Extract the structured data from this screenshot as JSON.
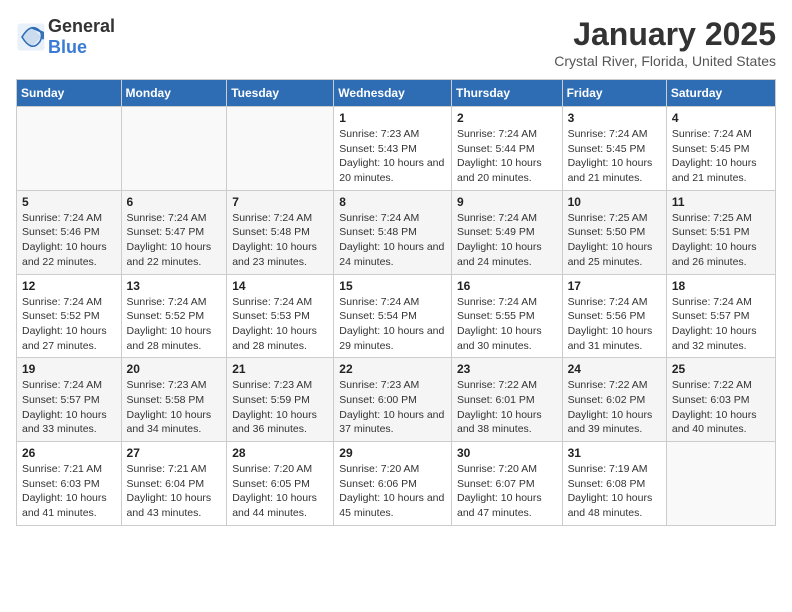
{
  "header": {
    "logo_general": "General",
    "logo_blue": "Blue",
    "title": "January 2025",
    "subtitle": "Crystal River, Florida, United States"
  },
  "calendar": {
    "days_of_week": [
      "Sunday",
      "Monday",
      "Tuesday",
      "Wednesday",
      "Thursday",
      "Friday",
      "Saturday"
    ],
    "weeks": [
      [
        {
          "day": "",
          "sunrise": "",
          "sunset": "",
          "daylight": ""
        },
        {
          "day": "",
          "sunrise": "",
          "sunset": "",
          "daylight": ""
        },
        {
          "day": "",
          "sunrise": "",
          "sunset": "",
          "daylight": ""
        },
        {
          "day": "1",
          "sunrise": "Sunrise: 7:23 AM",
          "sunset": "Sunset: 5:43 PM",
          "daylight": "Daylight: 10 hours and 20 minutes."
        },
        {
          "day": "2",
          "sunrise": "Sunrise: 7:24 AM",
          "sunset": "Sunset: 5:44 PM",
          "daylight": "Daylight: 10 hours and 20 minutes."
        },
        {
          "day": "3",
          "sunrise": "Sunrise: 7:24 AM",
          "sunset": "Sunset: 5:45 PM",
          "daylight": "Daylight: 10 hours and 21 minutes."
        },
        {
          "day": "4",
          "sunrise": "Sunrise: 7:24 AM",
          "sunset": "Sunset: 5:45 PM",
          "daylight": "Daylight: 10 hours and 21 minutes."
        }
      ],
      [
        {
          "day": "5",
          "sunrise": "Sunrise: 7:24 AM",
          "sunset": "Sunset: 5:46 PM",
          "daylight": "Daylight: 10 hours and 22 minutes."
        },
        {
          "day": "6",
          "sunrise": "Sunrise: 7:24 AM",
          "sunset": "Sunset: 5:47 PM",
          "daylight": "Daylight: 10 hours and 22 minutes."
        },
        {
          "day": "7",
          "sunrise": "Sunrise: 7:24 AM",
          "sunset": "Sunset: 5:48 PM",
          "daylight": "Daylight: 10 hours and 23 minutes."
        },
        {
          "day": "8",
          "sunrise": "Sunrise: 7:24 AM",
          "sunset": "Sunset: 5:48 PM",
          "daylight": "Daylight: 10 hours and 24 minutes."
        },
        {
          "day": "9",
          "sunrise": "Sunrise: 7:24 AM",
          "sunset": "Sunset: 5:49 PM",
          "daylight": "Daylight: 10 hours and 24 minutes."
        },
        {
          "day": "10",
          "sunrise": "Sunrise: 7:25 AM",
          "sunset": "Sunset: 5:50 PM",
          "daylight": "Daylight: 10 hours and 25 minutes."
        },
        {
          "day": "11",
          "sunrise": "Sunrise: 7:25 AM",
          "sunset": "Sunset: 5:51 PM",
          "daylight": "Daylight: 10 hours and 26 minutes."
        }
      ],
      [
        {
          "day": "12",
          "sunrise": "Sunrise: 7:24 AM",
          "sunset": "Sunset: 5:52 PM",
          "daylight": "Daylight: 10 hours and 27 minutes."
        },
        {
          "day": "13",
          "sunrise": "Sunrise: 7:24 AM",
          "sunset": "Sunset: 5:52 PM",
          "daylight": "Daylight: 10 hours and 28 minutes."
        },
        {
          "day": "14",
          "sunrise": "Sunrise: 7:24 AM",
          "sunset": "Sunset: 5:53 PM",
          "daylight": "Daylight: 10 hours and 28 minutes."
        },
        {
          "day": "15",
          "sunrise": "Sunrise: 7:24 AM",
          "sunset": "Sunset: 5:54 PM",
          "daylight": "Daylight: 10 hours and 29 minutes."
        },
        {
          "day": "16",
          "sunrise": "Sunrise: 7:24 AM",
          "sunset": "Sunset: 5:55 PM",
          "daylight": "Daylight: 10 hours and 30 minutes."
        },
        {
          "day": "17",
          "sunrise": "Sunrise: 7:24 AM",
          "sunset": "Sunset: 5:56 PM",
          "daylight": "Daylight: 10 hours and 31 minutes."
        },
        {
          "day": "18",
          "sunrise": "Sunrise: 7:24 AM",
          "sunset": "Sunset: 5:57 PM",
          "daylight": "Daylight: 10 hours and 32 minutes."
        }
      ],
      [
        {
          "day": "19",
          "sunrise": "Sunrise: 7:24 AM",
          "sunset": "Sunset: 5:57 PM",
          "daylight": "Daylight: 10 hours and 33 minutes."
        },
        {
          "day": "20",
          "sunrise": "Sunrise: 7:23 AM",
          "sunset": "Sunset: 5:58 PM",
          "daylight": "Daylight: 10 hours and 34 minutes."
        },
        {
          "day": "21",
          "sunrise": "Sunrise: 7:23 AM",
          "sunset": "Sunset: 5:59 PM",
          "daylight": "Daylight: 10 hours and 36 minutes."
        },
        {
          "day": "22",
          "sunrise": "Sunrise: 7:23 AM",
          "sunset": "Sunset: 6:00 PM",
          "daylight": "Daylight: 10 hours and 37 minutes."
        },
        {
          "day": "23",
          "sunrise": "Sunrise: 7:22 AM",
          "sunset": "Sunset: 6:01 PM",
          "daylight": "Daylight: 10 hours and 38 minutes."
        },
        {
          "day": "24",
          "sunrise": "Sunrise: 7:22 AM",
          "sunset": "Sunset: 6:02 PM",
          "daylight": "Daylight: 10 hours and 39 minutes."
        },
        {
          "day": "25",
          "sunrise": "Sunrise: 7:22 AM",
          "sunset": "Sunset: 6:03 PM",
          "daylight": "Daylight: 10 hours and 40 minutes."
        }
      ],
      [
        {
          "day": "26",
          "sunrise": "Sunrise: 7:21 AM",
          "sunset": "Sunset: 6:03 PM",
          "daylight": "Daylight: 10 hours and 41 minutes."
        },
        {
          "day": "27",
          "sunrise": "Sunrise: 7:21 AM",
          "sunset": "Sunset: 6:04 PM",
          "daylight": "Daylight: 10 hours and 43 minutes."
        },
        {
          "day": "28",
          "sunrise": "Sunrise: 7:20 AM",
          "sunset": "Sunset: 6:05 PM",
          "daylight": "Daylight: 10 hours and 44 minutes."
        },
        {
          "day": "29",
          "sunrise": "Sunrise: 7:20 AM",
          "sunset": "Sunset: 6:06 PM",
          "daylight": "Daylight: 10 hours and 45 minutes."
        },
        {
          "day": "30",
          "sunrise": "Sunrise: 7:20 AM",
          "sunset": "Sunset: 6:07 PM",
          "daylight": "Daylight: 10 hours and 47 minutes."
        },
        {
          "day": "31",
          "sunrise": "Sunrise: 7:19 AM",
          "sunset": "Sunset: 6:08 PM",
          "daylight": "Daylight: 10 hours and 48 minutes."
        },
        {
          "day": "",
          "sunrise": "",
          "sunset": "",
          "daylight": ""
        }
      ]
    ]
  }
}
